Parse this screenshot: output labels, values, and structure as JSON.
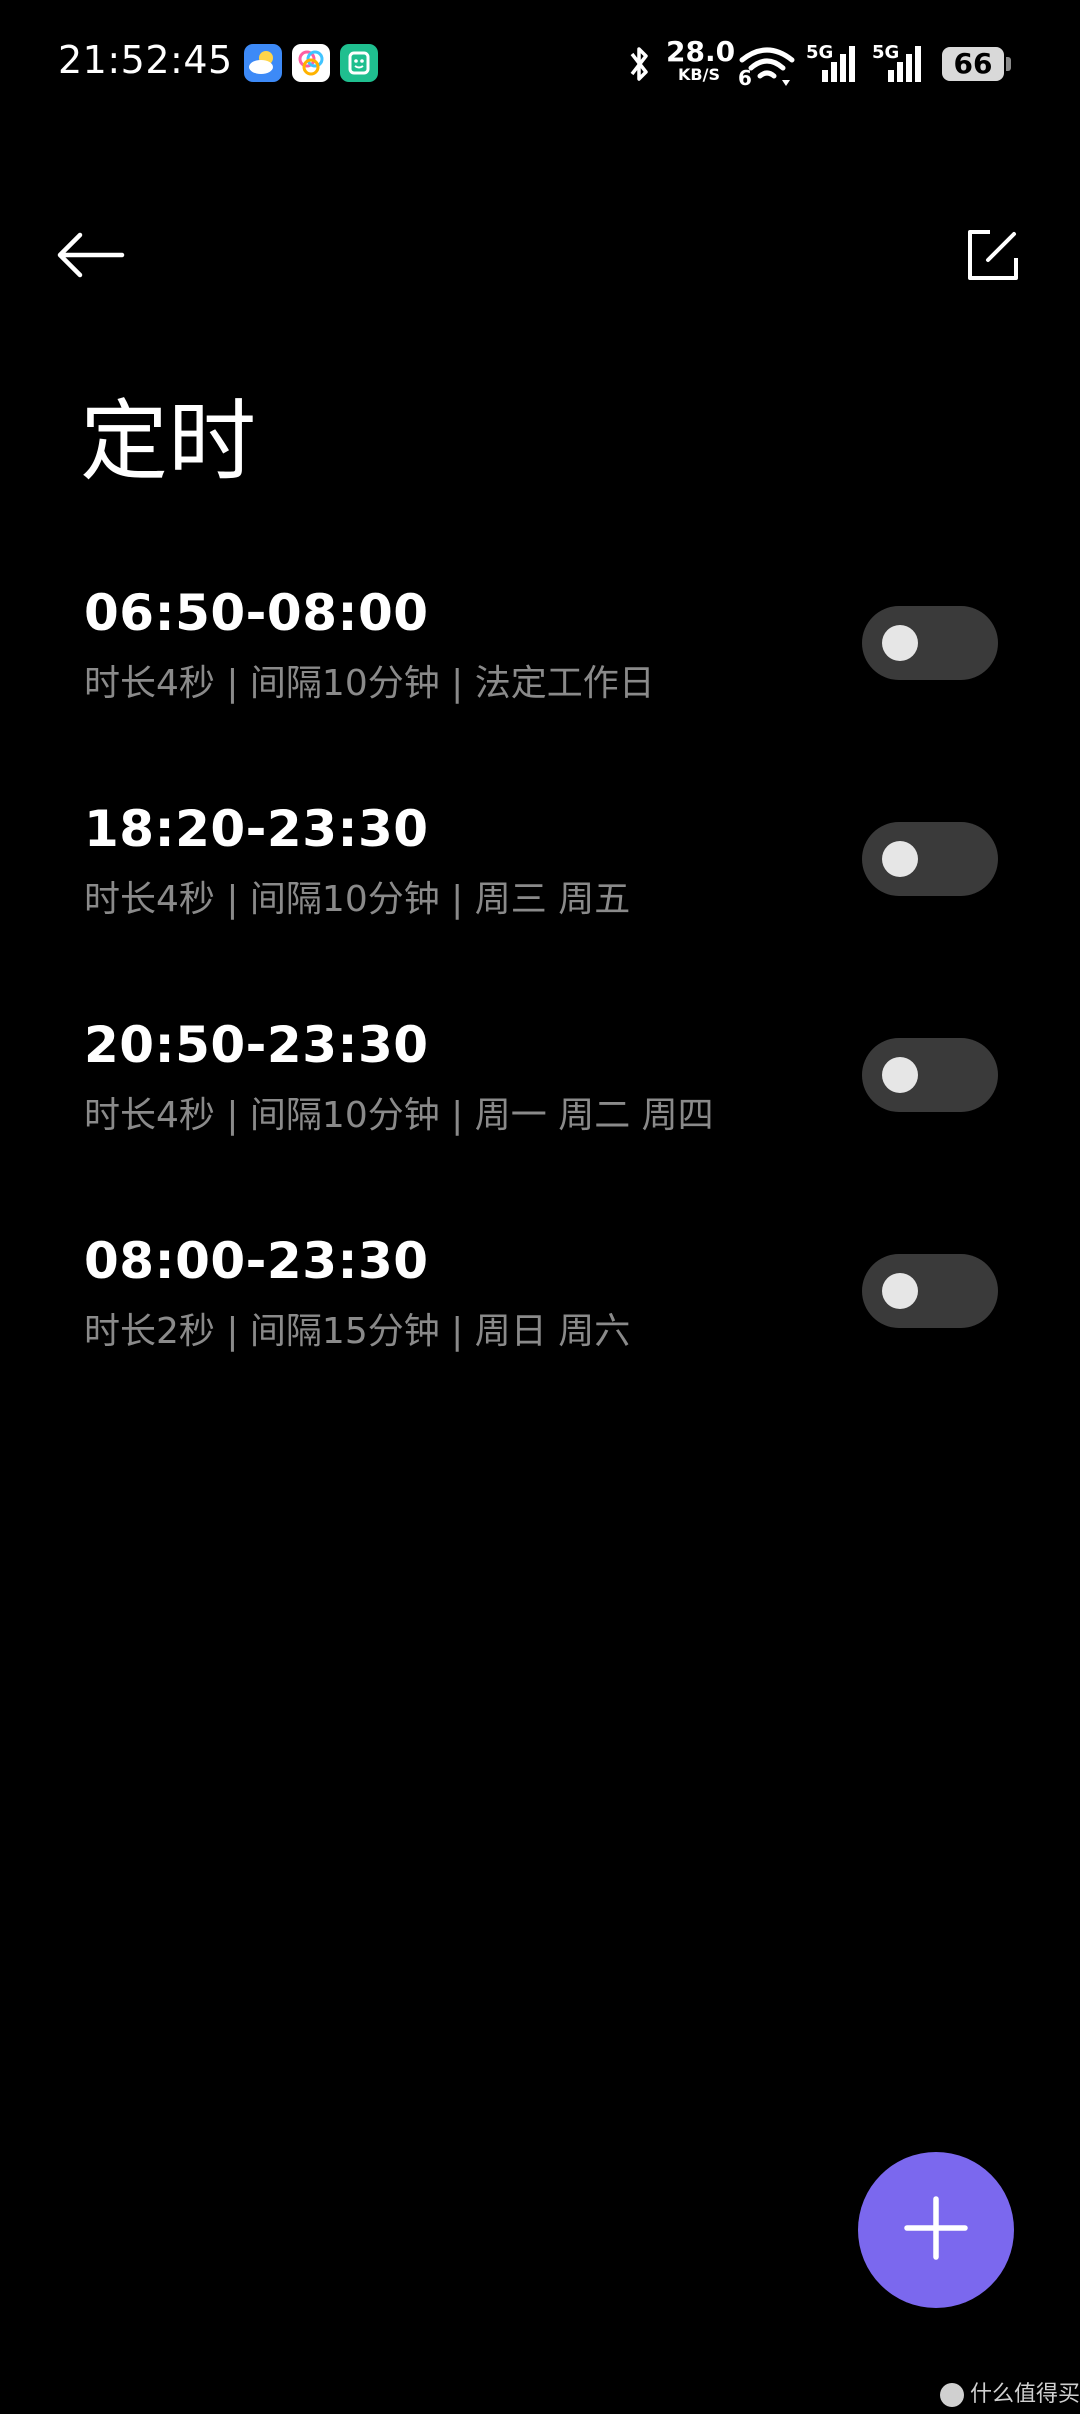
{
  "status_bar": {
    "time": "21:52:45",
    "app_icons": [
      "weather-app-icon",
      "gallery-app-icon",
      "mi-home-app-icon"
    ],
    "network_speed": "28.0",
    "network_speed_unit": "KB/S",
    "wifi_label": "6",
    "sim1_label": "5G",
    "sim2_label": "5G",
    "battery": "66"
  },
  "toolbar": {
    "back_icon": "back-arrow-icon",
    "edit_icon": "edit-icon"
  },
  "page": {
    "title": "定时"
  },
  "schedules": [
    {
      "time": "06:50-08:00",
      "detail": "时长4秒 | 间隔10分钟 | 法定工作日",
      "enabled": false
    },
    {
      "time": "18:20-23:30",
      "detail": "时长4秒 | 间隔10分钟 | 周三 周五",
      "enabled": false
    },
    {
      "time": "20:50-23:30",
      "detail": "时长4秒 | 间隔10分钟 | 周一 周二 周四",
      "enabled": false
    },
    {
      "time": "08:00-23:30",
      "detail": "时长2秒 | 间隔15分钟 | 周日 周六",
      "enabled": false
    }
  ],
  "fab": {
    "icon": "plus-icon"
  },
  "watermark": {
    "text": "什么值得买"
  },
  "colors": {
    "background": "#000000",
    "accent": "#7b68ee",
    "toggle_off": "#3a3a3a",
    "secondary_text": "#8a8a8a"
  }
}
